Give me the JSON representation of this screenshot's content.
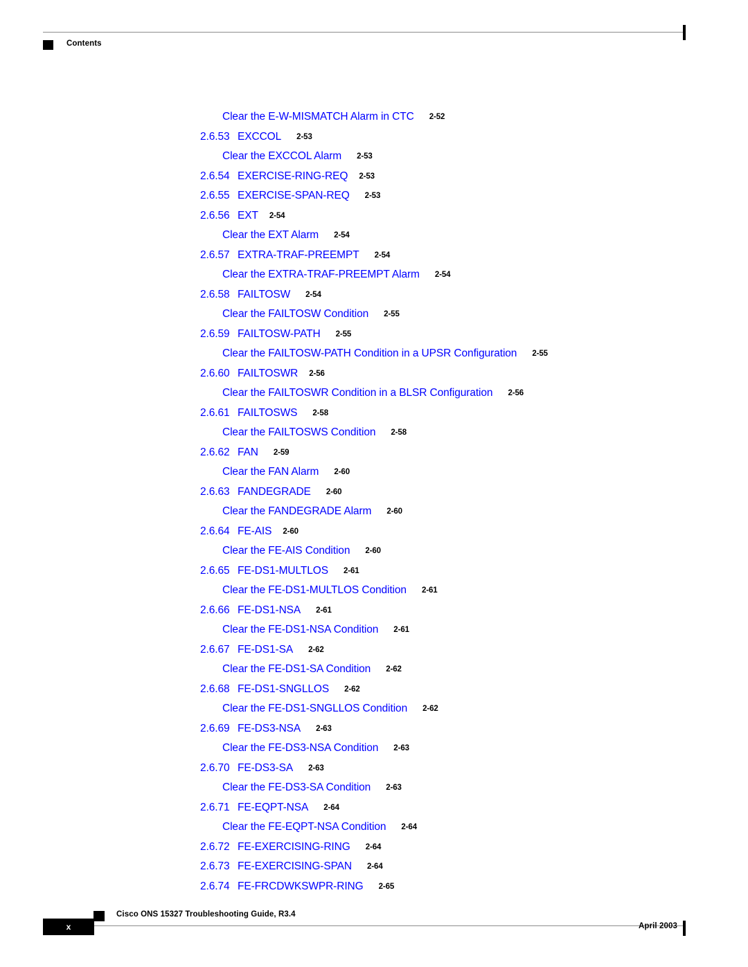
{
  "header": {
    "square_icon": "black-square-bullet",
    "label": "Contents"
  },
  "toc": {
    "rows": [
      {
        "level": 2,
        "number": "",
        "title": "Clear the E-W-MISMATCH Alarm in CTC",
        "page": "2-52",
        "gap": "m"
      },
      {
        "level": 1,
        "number": "2.6.53",
        "title": "EXCCOL",
        "page": "2-53",
        "gap": "m"
      },
      {
        "level": 2,
        "number": "",
        "title": "Clear the EXCCOL Alarm",
        "page": "2-53",
        "gap": "m"
      },
      {
        "level": 1,
        "number": "2.6.54",
        "title": "EXERCISE-RING-REQ",
        "page": "2-53",
        "gap": "s"
      },
      {
        "level": 1,
        "number": "2.6.55",
        "title": "EXERCISE-SPAN-REQ",
        "page": "2-53",
        "gap": "m"
      },
      {
        "level": 1,
        "number": "2.6.56",
        "title": "EXT",
        "page": "2-54",
        "gap": "s"
      },
      {
        "level": 2,
        "number": "",
        "title": "Clear the EXT Alarm",
        "page": "2-54",
        "gap": "m"
      },
      {
        "level": 1,
        "number": "2.6.57",
        "title": "EXTRA-TRAF-PREEMPT",
        "page": "2-54",
        "gap": "m"
      },
      {
        "level": 2,
        "number": "",
        "title": "Clear the EXTRA-TRAF-PREEMPT Alarm",
        "page": "2-54",
        "gap": "m"
      },
      {
        "level": 1,
        "number": "2.6.58",
        "title": "FAILTOSW",
        "page": "2-54",
        "gap": "m"
      },
      {
        "level": 2,
        "number": "",
        "title": "Clear the FAILTOSW Condition",
        "page": "2-55",
        "gap": "m"
      },
      {
        "level": 1,
        "number": "2.6.59",
        "title": "FAILTOSW-PATH",
        "page": "2-55",
        "gap": "m"
      },
      {
        "level": 2,
        "number": "",
        "title": "Clear the FAILTOSW-PATH Condition in a UPSR Configuration",
        "page": "2-55",
        "gap": "m"
      },
      {
        "level": 1,
        "number": "2.6.60",
        "title": "FAILTOSWR",
        "page": "2-56",
        "gap": "s"
      },
      {
        "level": 2,
        "number": "",
        "title": "Clear the FAILTOSWR Condition in a BLSR Configuration",
        "page": "2-56",
        "gap": "m"
      },
      {
        "level": 1,
        "number": "2.6.61",
        "title": "FAILTOSWS",
        "page": "2-58",
        "gap": "m"
      },
      {
        "level": 2,
        "number": "",
        "title": "Clear the FAILTOSWS Condition",
        "page": "2-58",
        "gap": "m"
      },
      {
        "level": 1,
        "number": "2.6.62",
        "title": "FAN",
        "page": "2-59",
        "gap": "m"
      },
      {
        "level": 2,
        "number": "",
        "title": "Clear the FAN Alarm",
        "page": "2-60",
        "gap": "m"
      },
      {
        "level": 1,
        "number": "2.6.63",
        "title": "FANDEGRADE",
        "page": "2-60",
        "gap": "m"
      },
      {
        "level": 2,
        "number": "",
        "title": "Clear the FANDEGRADE Alarm",
        "page": "2-60",
        "gap": "m"
      },
      {
        "level": 1,
        "number": "2.6.64",
        "title": "FE-AIS",
        "page": "2-60",
        "gap": "s"
      },
      {
        "level": 2,
        "number": "",
        "title": "Clear the FE-AIS Condition",
        "page": "2-60",
        "gap": "m"
      },
      {
        "level": 1,
        "number": "2.6.65",
        "title": "FE-DS1-MULTLOS",
        "page": "2-61",
        "gap": "m"
      },
      {
        "level": 2,
        "number": "",
        "title": "Clear the FE-DS1-MULTLOS Condition",
        "page": "2-61",
        "gap": "m"
      },
      {
        "level": 1,
        "number": "2.6.66",
        "title": "FE-DS1-NSA",
        "page": "2-61",
        "gap": "m"
      },
      {
        "level": 2,
        "number": "",
        "title": "Clear the FE-DS1-NSA Condition",
        "page": "2-61",
        "gap": "m"
      },
      {
        "level": 1,
        "number": "2.6.67",
        "title": "FE-DS1-SA",
        "page": "2-62",
        "gap": "m"
      },
      {
        "level": 2,
        "number": "",
        "title": "Clear the FE-DS1-SA Condition",
        "page": "2-62",
        "gap": "m"
      },
      {
        "level": 1,
        "number": "2.6.68",
        "title": "FE-DS1-SNGLLOS",
        "page": "2-62",
        "gap": "m"
      },
      {
        "level": 2,
        "number": "",
        "title": "Clear the FE-DS1-SNGLLOS Condition",
        "page": "2-62",
        "gap": "m"
      },
      {
        "level": 1,
        "number": "2.6.69",
        "title": "FE-DS3-NSA",
        "page": "2-63",
        "gap": "m"
      },
      {
        "level": 2,
        "number": "",
        "title": "Clear the FE-DS3-NSA Condition",
        "page": "2-63",
        "gap": "m"
      },
      {
        "level": 1,
        "number": "2.6.70",
        "title": "FE-DS3-SA",
        "page": "2-63",
        "gap": "m"
      },
      {
        "level": 2,
        "number": "",
        "title": "Clear the FE-DS3-SA Condition",
        "page": "2-63",
        "gap": "m"
      },
      {
        "level": 1,
        "number": "2.6.71",
        "title": "FE-EQPT-NSA",
        "page": "2-64",
        "gap": "m"
      },
      {
        "level": 2,
        "number": "",
        "title": "Clear the FE-EQPT-NSA Condition",
        "page": "2-64",
        "gap": "m"
      },
      {
        "level": 1,
        "number": "2.6.72",
        "title": "FE-EXERCISING-RING",
        "page": "2-64",
        "gap": "m"
      },
      {
        "level": 1,
        "number": "2.6.73",
        "title": "FE-EXERCISING-SPAN",
        "page": "2-64",
        "gap": "m"
      },
      {
        "level": 1,
        "number": "2.6.74",
        "title": "FE-FRCDWKSWPR-RING",
        "page": "2-65",
        "gap": "m"
      }
    ]
  },
  "footer": {
    "page_number": "x",
    "square_icon": "black-square-bullet",
    "title": "Cisco ONS 15327 Troubleshooting Guide, R3.4",
    "date": "April 2003"
  },
  "colors": {
    "link": "#0000ff",
    "text": "#000000",
    "rule": "#8c8c8c",
    "background": "#ffffff"
  }
}
